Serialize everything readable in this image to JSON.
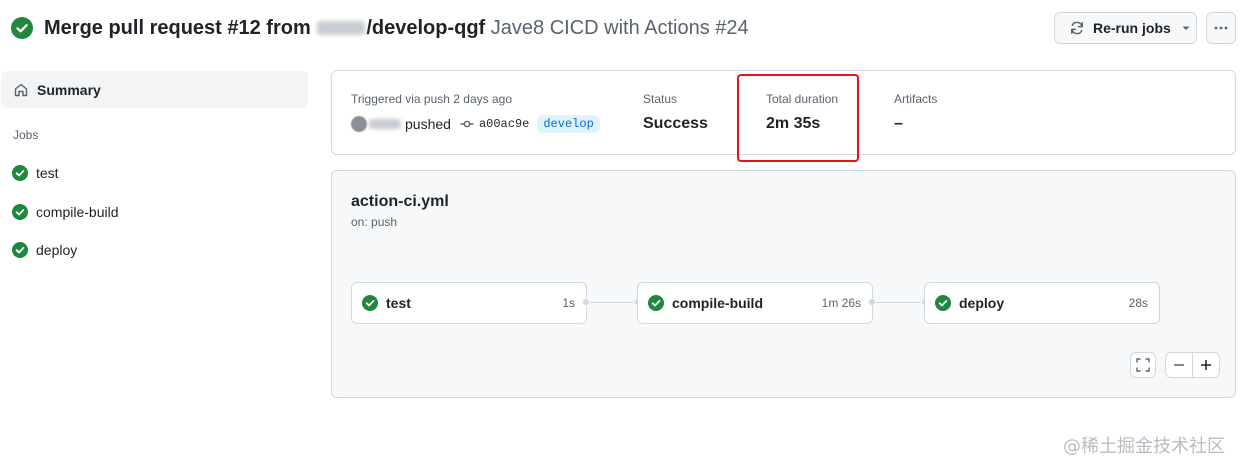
{
  "header": {
    "title_prefix": "Merge pull request #12 from",
    "title_suffix": "/develop-qgf",
    "subtitle": "Jave8 CICD with Actions #24",
    "rerun_label": "Re-run jobs"
  },
  "sidebar": {
    "summary_label": "Summary",
    "jobs_label": "Jobs",
    "jobs": [
      {
        "label": "test",
        "status": "success"
      },
      {
        "label": "compile-build",
        "status": "success"
      },
      {
        "label": "deploy",
        "status": "success"
      }
    ]
  },
  "run_summary": {
    "triggered_label": "Triggered via push 2 days ago",
    "pushed_text": "pushed",
    "commit_sha": "a00ac9e",
    "branch": "develop",
    "status_label": "Status",
    "status_value": "Success",
    "duration_label": "Total duration",
    "duration_value": "2m 35s",
    "artifacts_label": "Artifacts",
    "artifacts_value": "–"
  },
  "workflow": {
    "file": "action-ci.yml",
    "trigger": "on: push",
    "jobs": [
      {
        "name": "test",
        "duration": "1s"
      },
      {
        "name": "compile-build",
        "duration": "1m 26s"
      },
      {
        "name": "deploy",
        "duration": "28s"
      }
    ]
  },
  "colors": {
    "success": "#1f883d",
    "highlight": "#e5141a",
    "branch_bg": "#ddf4ff",
    "branch_fg": "#0969da"
  },
  "watermark": "@稀土掘金技术社区"
}
